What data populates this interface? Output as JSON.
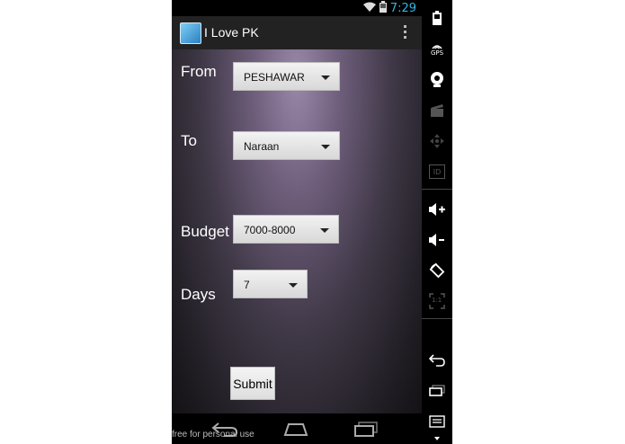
{
  "status_bar": {
    "time": "7:29",
    "icons": [
      "wifi-icon",
      "battery-icon"
    ]
  },
  "action_bar": {
    "app_icon": "app-icon",
    "title": "I Love PK",
    "menu_icon": "overflow-menu-icon"
  },
  "form": {
    "from": {
      "label": "From",
      "selected": "PESHAWAR"
    },
    "to": {
      "label": "To",
      "selected": "Naraan"
    },
    "budget": {
      "label": "Budget",
      "selected": "7000-8000"
    },
    "days": {
      "label": "Days",
      "selected": "7"
    },
    "submit_label": "Submit"
  },
  "nav_bar": {
    "buttons": [
      "back-icon",
      "home-icon",
      "recent-apps-icon"
    ]
  },
  "watermark": "free for personal use",
  "emulator_sidebar": {
    "icons": [
      "battery-icon",
      "gps-icon",
      "camera-icon",
      "clapper-icon",
      "dpad-icon",
      "id-icon",
      "volume-up-icon",
      "volume-down-icon",
      "rotate-icon",
      "scale-icon",
      "back-icon",
      "recent-apps-icon",
      "menu-icon"
    ],
    "gps_label": "GPS",
    "id_label": "ID",
    "scale_label": "1:1"
  },
  "colors": {
    "status_accent": "#33b5e5",
    "action_bar": "#222222",
    "background_glow": "#9a88a8"
  }
}
